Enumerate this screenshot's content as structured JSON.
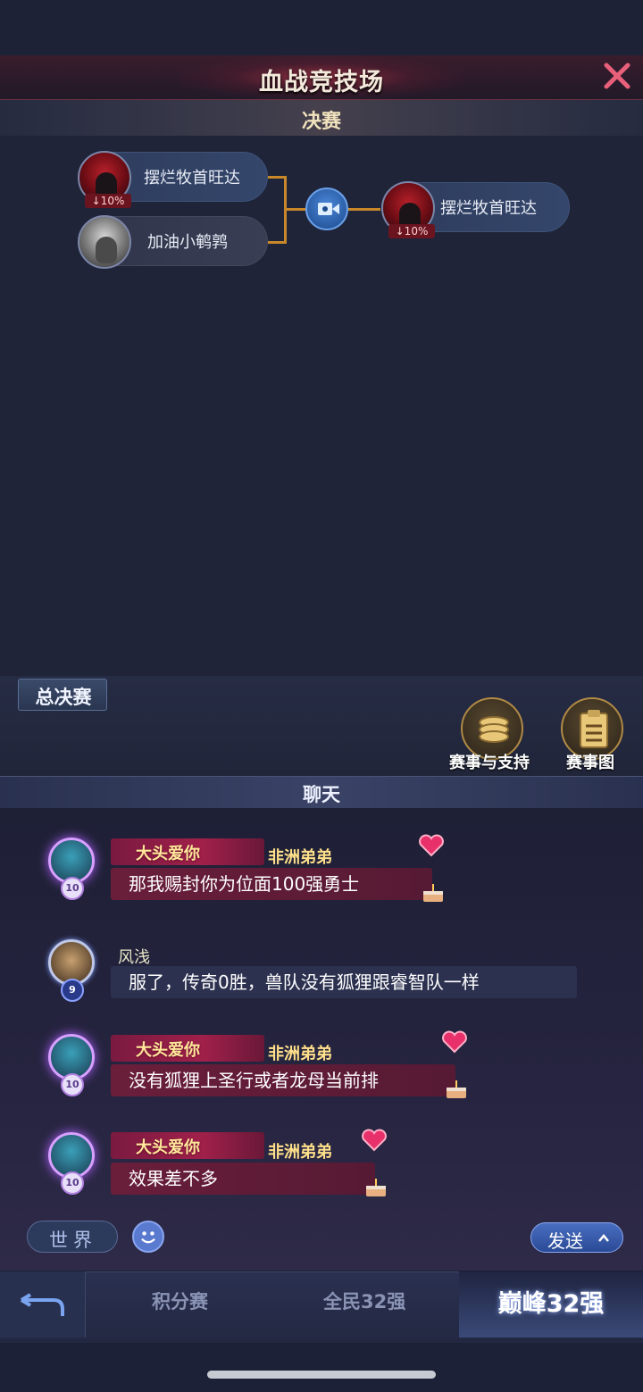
{
  "header": {
    "title": "血战竞技场",
    "section_title": "决赛"
  },
  "bracket": {
    "players": [
      {
        "name": "摆烂牧首旺达",
        "badge": "↓10%"
      },
      {
        "name": "加油小鹌鹑",
        "badge": ""
      }
    ],
    "winner": {
      "name": "摆烂牧首旺达",
      "badge": "↓10%"
    }
  },
  "controls": {
    "grand_final_tab": "总决赛",
    "support_label": "赛事与支持",
    "chart_label": "赛事图"
  },
  "chat": {
    "title": "聊天",
    "messages": [
      {
        "title_tag": "大头爱你",
        "nickname": "非洲弟弟",
        "text": "那我赐封你为位面100强勇士",
        "level": "10"
      },
      {
        "title_tag": "",
        "nickname": "风浅",
        "text": "服了，传奇0胜，兽队没有狐狸跟睿智队一样",
        "level": "9"
      },
      {
        "title_tag": "大头爱你",
        "nickname": "非洲弟弟",
        "text": "没有狐狸上圣行或者龙母当前排",
        "level": "10"
      },
      {
        "title_tag": "大头爱你",
        "nickname": "非洲弟弟",
        "text": "效果差不多",
        "level": "10"
      }
    ],
    "channel": "世界",
    "input_placeholder": "",
    "send_label": "发送"
  },
  "nav": {
    "tabs": [
      "积分赛",
      "全民32强",
      "巅峰32强"
    ],
    "active_index": 2
  },
  "colors": {
    "accent_gold": "#f0e2bd",
    "bracket_line": "#c8882a",
    "chat_bubble_pink": "#6a1e3a"
  }
}
